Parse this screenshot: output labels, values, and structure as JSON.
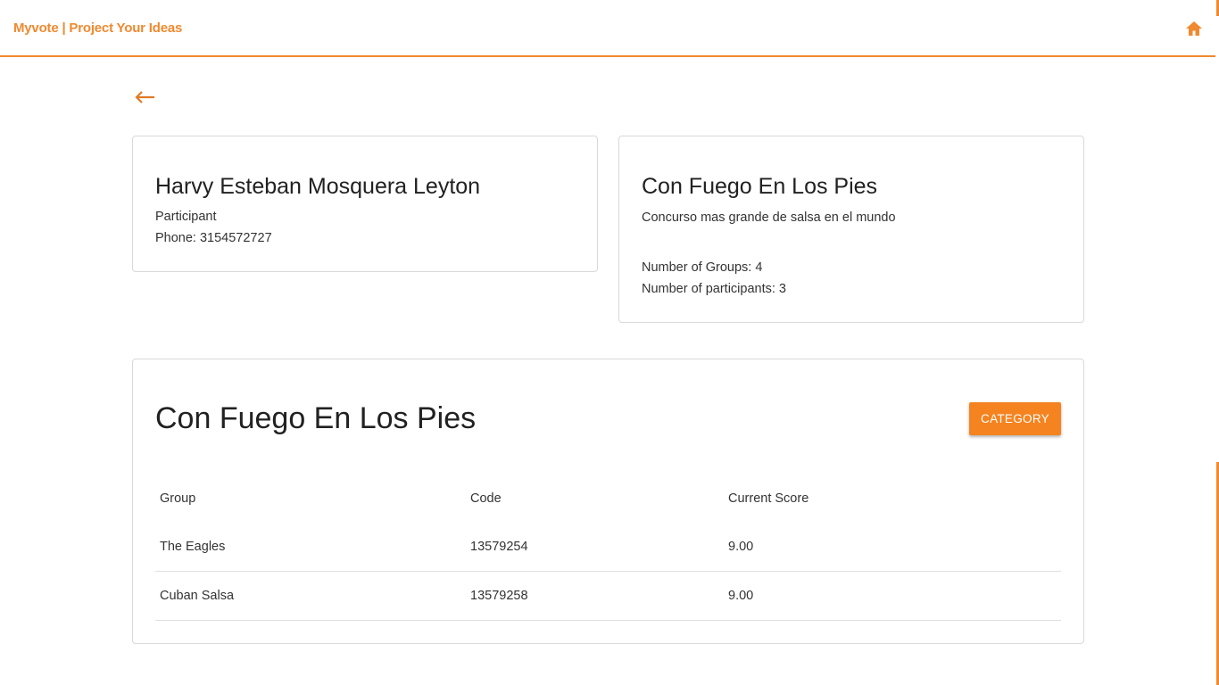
{
  "header": {
    "brand": "Myvote | Project Your Ideas",
    "home_icon": "home-icon"
  },
  "nav": {
    "back_icon": "arrow-left-icon"
  },
  "participant": {
    "name": "Harvy Esteban Mosquera Leyton",
    "role": "Participant",
    "phone": "Phone: 3154572727"
  },
  "event": {
    "title": "Con Fuego En Los Pies",
    "description": "Concurso mas grande de salsa en el mundo",
    "groups": "Number of Groups: 4",
    "participants": "Number of participants: 3"
  },
  "groups_table": {
    "title": "Con Fuego En Los Pies",
    "category_button": "CATEGORY",
    "columns": [
      "Group",
      "Code",
      "Current Score"
    ],
    "rows": [
      [
        "The Eagles",
        "13579254",
        "9.00"
      ],
      [
        "Cuban Salsa",
        "13579258",
        "9.00"
      ]
    ]
  },
  "colors": {
    "accent": "#f0892f",
    "button": "#f5831f",
    "text": "#212121",
    "border": "#d9d9d9"
  }
}
